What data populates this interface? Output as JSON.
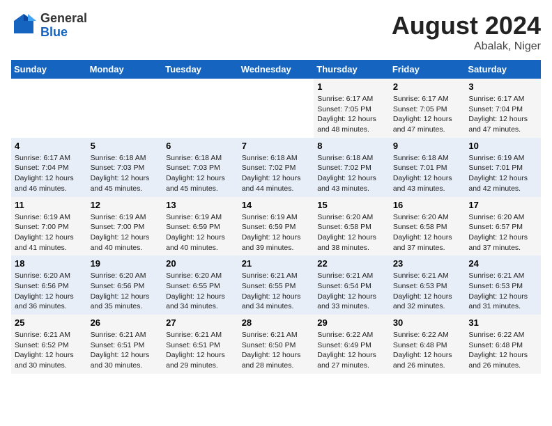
{
  "logo": {
    "general": "General",
    "blue": "Blue"
  },
  "title": "August 2024",
  "location": "Abalak, Niger",
  "days_header": [
    "Sunday",
    "Monday",
    "Tuesday",
    "Wednesday",
    "Thursday",
    "Friday",
    "Saturday"
  ],
  "weeks": [
    [
      {
        "day": "",
        "info": ""
      },
      {
        "day": "",
        "info": ""
      },
      {
        "day": "",
        "info": ""
      },
      {
        "day": "",
        "info": ""
      },
      {
        "day": "1",
        "info": "Sunrise: 6:17 AM\nSunset: 7:05 PM\nDaylight: 12 hours\nand 48 minutes."
      },
      {
        "day": "2",
        "info": "Sunrise: 6:17 AM\nSunset: 7:05 PM\nDaylight: 12 hours\nand 47 minutes."
      },
      {
        "day": "3",
        "info": "Sunrise: 6:17 AM\nSunset: 7:04 PM\nDaylight: 12 hours\nand 47 minutes."
      }
    ],
    [
      {
        "day": "4",
        "info": "Sunrise: 6:17 AM\nSunset: 7:04 PM\nDaylight: 12 hours\nand 46 minutes."
      },
      {
        "day": "5",
        "info": "Sunrise: 6:18 AM\nSunset: 7:03 PM\nDaylight: 12 hours\nand 45 minutes."
      },
      {
        "day": "6",
        "info": "Sunrise: 6:18 AM\nSunset: 7:03 PM\nDaylight: 12 hours\nand 45 minutes."
      },
      {
        "day": "7",
        "info": "Sunrise: 6:18 AM\nSunset: 7:02 PM\nDaylight: 12 hours\nand 44 minutes."
      },
      {
        "day": "8",
        "info": "Sunrise: 6:18 AM\nSunset: 7:02 PM\nDaylight: 12 hours\nand 43 minutes."
      },
      {
        "day": "9",
        "info": "Sunrise: 6:18 AM\nSunset: 7:01 PM\nDaylight: 12 hours\nand 43 minutes."
      },
      {
        "day": "10",
        "info": "Sunrise: 6:19 AM\nSunset: 7:01 PM\nDaylight: 12 hours\nand 42 minutes."
      }
    ],
    [
      {
        "day": "11",
        "info": "Sunrise: 6:19 AM\nSunset: 7:00 PM\nDaylight: 12 hours\nand 41 minutes."
      },
      {
        "day": "12",
        "info": "Sunrise: 6:19 AM\nSunset: 7:00 PM\nDaylight: 12 hours\nand 40 minutes."
      },
      {
        "day": "13",
        "info": "Sunrise: 6:19 AM\nSunset: 6:59 PM\nDaylight: 12 hours\nand 40 minutes."
      },
      {
        "day": "14",
        "info": "Sunrise: 6:19 AM\nSunset: 6:59 PM\nDaylight: 12 hours\nand 39 minutes."
      },
      {
        "day": "15",
        "info": "Sunrise: 6:20 AM\nSunset: 6:58 PM\nDaylight: 12 hours\nand 38 minutes."
      },
      {
        "day": "16",
        "info": "Sunrise: 6:20 AM\nSunset: 6:58 PM\nDaylight: 12 hours\nand 37 minutes."
      },
      {
        "day": "17",
        "info": "Sunrise: 6:20 AM\nSunset: 6:57 PM\nDaylight: 12 hours\nand 37 minutes."
      }
    ],
    [
      {
        "day": "18",
        "info": "Sunrise: 6:20 AM\nSunset: 6:56 PM\nDaylight: 12 hours\nand 36 minutes."
      },
      {
        "day": "19",
        "info": "Sunrise: 6:20 AM\nSunset: 6:56 PM\nDaylight: 12 hours\nand 35 minutes."
      },
      {
        "day": "20",
        "info": "Sunrise: 6:20 AM\nSunset: 6:55 PM\nDaylight: 12 hours\nand 34 minutes."
      },
      {
        "day": "21",
        "info": "Sunrise: 6:21 AM\nSunset: 6:55 PM\nDaylight: 12 hours\nand 34 minutes."
      },
      {
        "day": "22",
        "info": "Sunrise: 6:21 AM\nSunset: 6:54 PM\nDaylight: 12 hours\nand 33 minutes."
      },
      {
        "day": "23",
        "info": "Sunrise: 6:21 AM\nSunset: 6:53 PM\nDaylight: 12 hours\nand 32 minutes."
      },
      {
        "day": "24",
        "info": "Sunrise: 6:21 AM\nSunset: 6:53 PM\nDaylight: 12 hours\nand 31 minutes."
      }
    ],
    [
      {
        "day": "25",
        "info": "Sunrise: 6:21 AM\nSunset: 6:52 PM\nDaylight: 12 hours\nand 30 minutes."
      },
      {
        "day": "26",
        "info": "Sunrise: 6:21 AM\nSunset: 6:51 PM\nDaylight: 12 hours\nand 30 minutes."
      },
      {
        "day": "27",
        "info": "Sunrise: 6:21 AM\nSunset: 6:51 PM\nDaylight: 12 hours\nand 29 minutes."
      },
      {
        "day": "28",
        "info": "Sunrise: 6:21 AM\nSunset: 6:50 PM\nDaylight: 12 hours\nand 28 minutes."
      },
      {
        "day": "29",
        "info": "Sunrise: 6:22 AM\nSunset: 6:49 PM\nDaylight: 12 hours\nand 27 minutes."
      },
      {
        "day": "30",
        "info": "Sunrise: 6:22 AM\nSunset: 6:48 PM\nDaylight: 12 hours\nand 26 minutes."
      },
      {
        "day": "31",
        "info": "Sunrise: 6:22 AM\nSunset: 6:48 PM\nDaylight: 12 hours\nand 26 minutes."
      }
    ]
  ]
}
